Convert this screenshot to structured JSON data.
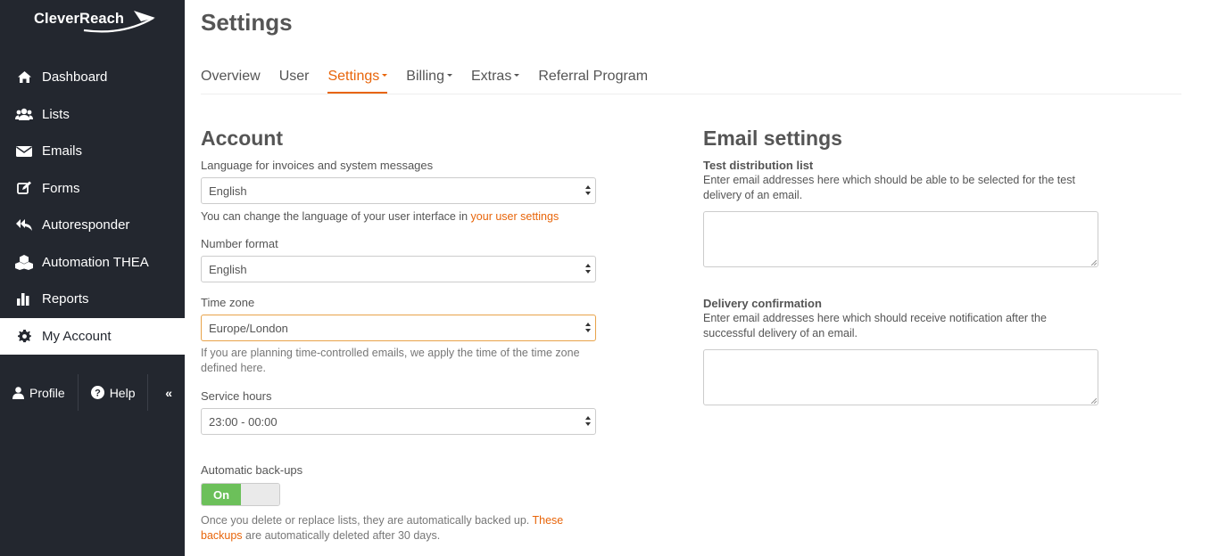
{
  "brand": {
    "name": "CleverReach"
  },
  "sidebar": {
    "items": [
      {
        "label": "Dashboard",
        "icon": "home-icon"
      },
      {
        "label": "Lists",
        "icon": "users-icon"
      },
      {
        "label": "Emails",
        "icon": "envelope-icon"
      },
      {
        "label": "Forms",
        "icon": "edit-icon"
      },
      {
        "label": "Autoresponder",
        "icon": "reply-all-icon"
      },
      {
        "label": "Automation THEA",
        "icon": "cubes-icon"
      },
      {
        "label": "Reports",
        "icon": "bar-chart-icon"
      },
      {
        "label": "My Account",
        "icon": "gear-icon",
        "active": true
      }
    ],
    "bottom": {
      "profile": "Profile",
      "help": "Help",
      "collapse": "«"
    }
  },
  "page": {
    "title": "Settings"
  },
  "tabs": [
    {
      "label": "Overview"
    },
    {
      "label": "User"
    },
    {
      "label": "Settings",
      "active": true,
      "dropdown": true
    },
    {
      "label": "Billing",
      "dropdown": true
    },
    {
      "label": "Extras",
      "dropdown": true
    },
    {
      "label": "Referral Program"
    }
  ],
  "account": {
    "title": "Account",
    "language_label": "Language for invoices and system messages",
    "language_value": "English",
    "language_help": "You can change the language of your user interface in ",
    "language_help_link": "your user settings",
    "number_label": "Number format",
    "number_value": "English",
    "timezone_label": "Time zone",
    "timezone_value": "Europe/London",
    "timezone_help": "If you are planning time-controlled emails, we apply the time of the time zone defined here.",
    "service_label": "Service hours",
    "service_value": "23:00 - 00:00",
    "backup_label": "Automatic back-ups",
    "backup_toggle": "On",
    "backup_help": "Once you delete or replace lists, they are automatically backed up. ",
    "backup_help_link": "These backups",
    "backup_help_end": " are automatically deleted after 30 days."
  },
  "email_settings": {
    "title": "Email settings",
    "test_label": "Test distribution list",
    "test_help": "Enter email addresses here which should be able to be selected for the test delivery of an email.",
    "test_value": "",
    "delivery_label": "Delivery confirmation",
    "delivery_help": "Enter email addresses here which should receive notification after the successful delivery of an email.",
    "delivery_value": ""
  },
  "colors": {
    "accent": "#e8650a",
    "sidebar": "#23272f",
    "toggle_on": "#6cc05a"
  }
}
